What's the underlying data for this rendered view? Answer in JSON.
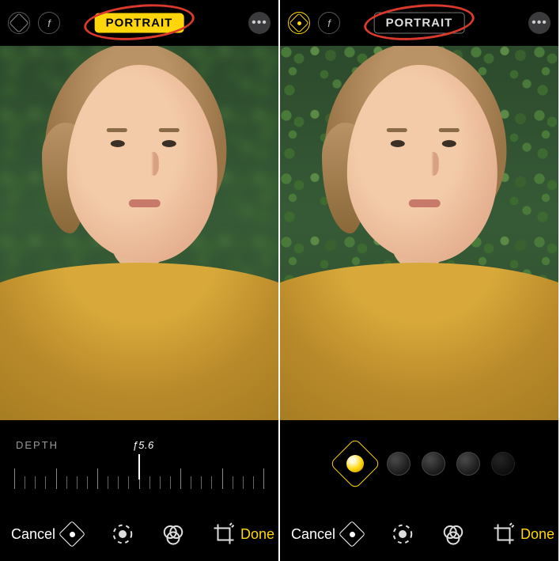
{
  "left": {
    "top": {
      "portrait_label": "PORTRAIT",
      "portrait_active": true
    },
    "strip": {
      "mode": "depth",
      "depth_label": "DEPTH",
      "depth_value": "ƒ5.6"
    },
    "bottom": {
      "cancel": "Cancel",
      "done": "Done",
      "active_tool": "portrait-lighting"
    }
  },
  "right": {
    "top": {
      "portrait_label": "PORTRAIT",
      "portrait_active": false
    },
    "strip": {
      "mode": "lighting",
      "selected": "natural-light"
    },
    "bottom": {
      "cancel": "Cancel",
      "done": "Done",
      "active_tool": "portrait-lighting"
    }
  },
  "icons": {
    "hex": "hexagon-icon",
    "aperture": "aperture-icon",
    "more": "more-icon",
    "adjust": "adjust-icon",
    "filters": "filters-icon",
    "crop": "crop-icon"
  }
}
